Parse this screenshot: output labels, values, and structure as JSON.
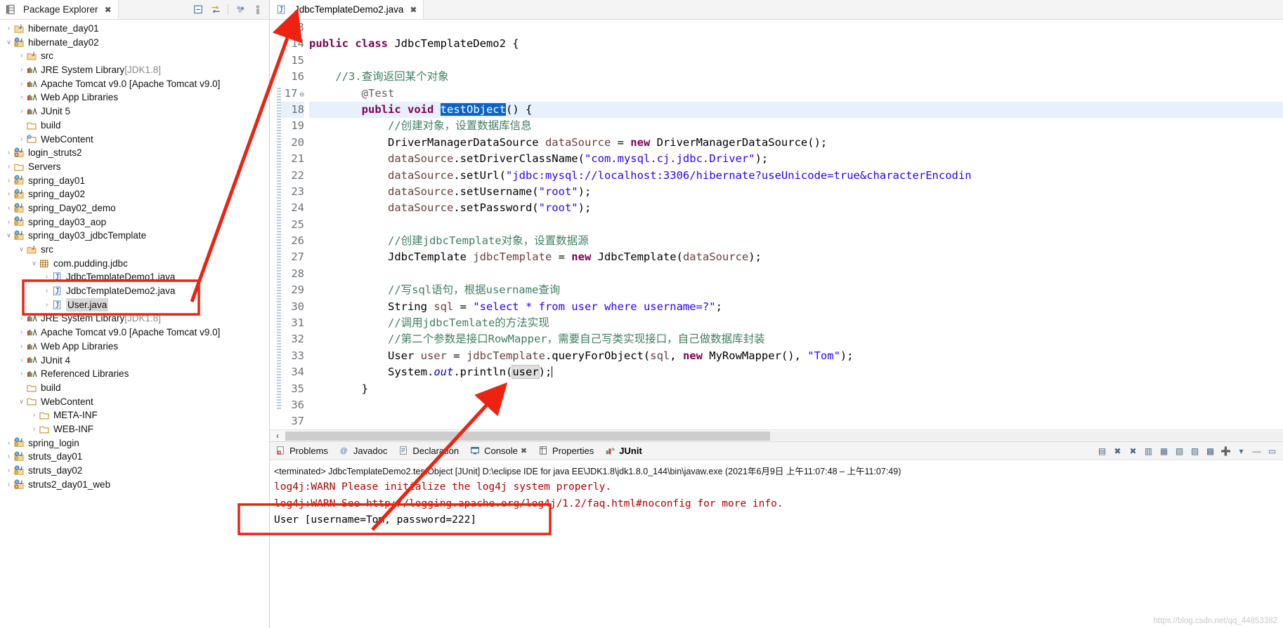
{
  "explorer": {
    "tab_title": "Package Explorer",
    "close_glyph": "✖",
    "toolbar": [
      {
        "name": "collapse-all-icon",
        "glyph": "▣"
      },
      {
        "name": "link-with-editor-icon",
        "glyph": "⇆"
      },
      {
        "name": "view-menu-icon",
        "glyph": "●"
      },
      {
        "name": "view-menu-chevron-icon",
        "glyph": "⋮"
      }
    ],
    "tree": [
      {
        "indent": 0,
        "arrow": "›",
        "icon": "java-project",
        "label": "hibernate_day01",
        "suffix": ""
      },
      {
        "indent": 0,
        "arrow": "ⱟ",
        "icon": "java-web-project",
        "label": "hibernate_day02",
        "suffix": ""
      },
      {
        "indent": 1,
        "arrow": "›",
        "icon": "source-folder",
        "label": "src",
        "suffix": ""
      },
      {
        "indent": 1,
        "arrow": "›",
        "icon": "library",
        "label": "JRE System Library",
        "suffix": "[JDK1.8]"
      },
      {
        "indent": 1,
        "arrow": "›",
        "icon": "library",
        "label": "Apache Tomcat v9.0 [Apache Tomcat v9.0]",
        "suffix": ""
      },
      {
        "indent": 1,
        "arrow": "›",
        "icon": "library",
        "label": "Web App Libraries",
        "suffix": ""
      },
      {
        "indent": 1,
        "arrow": "›",
        "icon": "library",
        "label": "JUnit 5",
        "suffix": ""
      },
      {
        "indent": 1,
        "arrow": "",
        "icon": "folder",
        "label": "build",
        "suffix": ""
      },
      {
        "indent": 1,
        "arrow": "›",
        "icon": "web-folder",
        "label": "WebContent",
        "suffix": ""
      },
      {
        "indent": 0,
        "arrow": "›",
        "icon": "java-web-project-error",
        "label": "login_struts2",
        "suffix": ""
      },
      {
        "indent": 0,
        "arrow": "›",
        "icon": "folder",
        "label": "Servers",
        "suffix": ""
      },
      {
        "indent": 0,
        "arrow": "›",
        "icon": "java-web-project",
        "label": "spring_day01",
        "suffix": ""
      },
      {
        "indent": 0,
        "arrow": "›",
        "icon": "java-web-project",
        "label": "spring_day02",
        "suffix": ""
      },
      {
        "indent": 0,
        "arrow": "›",
        "icon": "java-web-project",
        "label": "spring_Day02_demo",
        "suffix": ""
      },
      {
        "indent": 0,
        "arrow": "›",
        "icon": "java-web-project",
        "label": "spring_day03_aop",
        "suffix": ""
      },
      {
        "indent": 0,
        "arrow": "ⱟ",
        "icon": "java-web-project",
        "label": "spring_day03_jdbcTemplate",
        "suffix": ""
      },
      {
        "indent": 1,
        "arrow": "ⱟ",
        "icon": "source-folder",
        "label": "src",
        "suffix": ""
      },
      {
        "indent": 2,
        "arrow": "ⱟ",
        "icon": "package",
        "label": "com.pudding.jdbc",
        "suffix": ""
      },
      {
        "indent": 3,
        "arrow": "›",
        "icon": "java-file",
        "label": "JdbcTemplateDemo1.java",
        "suffix": ""
      },
      {
        "indent": 3,
        "arrow": "›",
        "icon": "java-file",
        "label": "JdbcTemplateDemo2.java",
        "suffix": ""
      },
      {
        "indent": 3,
        "arrow": "›",
        "icon": "java-file",
        "label": "User.java",
        "suffix": "",
        "selected": true
      },
      {
        "indent": 1,
        "arrow": "›",
        "icon": "library",
        "label": "JRE System Library",
        "suffix": "[JDK1.8]"
      },
      {
        "indent": 1,
        "arrow": "›",
        "icon": "library",
        "label": "Apache Tomcat v9.0 [Apache Tomcat v9.0]",
        "suffix": ""
      },
      {
        "indent": 1,
        "arrow": "›",
        "icon": "library",
        "label": "Web App Libraries",
        "suffix": ""
      },
      {
        "indent": 1,
        "arrow": "›",
        "icon": "library",
        "label": "JUnit 4",
        "suffix": ""
      },
      {
        "indent": 1,
        "arrow": "›",
        "icon": "library",
        "label": "Referenced Libraries",
        "suffix": ""
      },
      {
        "indent": 1,
        "arrow": "",
        "icon": "folder",
        "label": "build",
        "suffix": ""
      },
      {
        "indent": 1,
        "arrow": "ⱟ",
        "icon": "folder",
        "label": "WebContent",
        "suffix": ""
      },
      {
        "indent": 2,
        "arrow": "›",
        "icon": "folder",
        "label": "META-INF",
        "suffix": ""
      },
      {
        "indent": 2,
        "arrow": "›",
        "icon": "folder",
        "label": "WEB-INF",
        "suffix": ""
      },
      {
        "indent": 0,
        "arrow": "›",
        "icon": "java-web-project",
        "label": "spring_login",
        "suffix": ""
      },
      {
        "indent": 0,
        "arrow": "›",
        "icon": "java-web-project",
        "label": "struts_day01",
        "suffix": ""
      },
      {
        "indent": 0,
        "arrow": "›",
        "icon": "java-web-project",
        "label": "struts_day02",
        "suffix": ""
      },
      {
        "indent": 0,
        "arrow": "›",
        "icon": "java-web-project-error",
        "label": "struts2_day01_web",
        "suffix": ""
      }
    ]
  },
  "editor": {
    "tab_title": "JdbcTemplateDemo2.java",
    "close_glyph": "✖",
    "first_line": 13,
    "line_numbers": [
      13,
      14,
      15,
      16,
      17,
      18,
      19,
      20,
      21,
      22,
      23,
      24,
      25,
      26,
      27,
      28,
      29,
      30,
      31,
      32,
      33,
      34,
      35,
      36,
      37
    ],
    "current_line": 18,
    "selected_token": "testObject",
    "occurrence_token": "user",
    "scroll_left_glyph": "‹"
  },
  "console": {
    "tabs": [
      {
        "label": "Problems",
        "icon": "problems-icon",
        "active": false
      },
      {
        "label": "Javadoc",
        "icon": "javadoc-icon",
        "active": false
      },
      {
        "label": "Declaration",
        "icon": "declaration-icon",
        "active": false
      },
      {
        "label": "Console",
        "icon": "console-icon",
        "active": false,
        "closeable": true
      },
      {
        "label": "Properties",
        "icon": "properties-icon",
        "active": false
      },
      {
        "label": "JUnit",
        "icon": "junit-icon",
        "active": true
      }
    ],
    "toolbar": [
      {
        "name": "clear-console-icon",
        "glyph": "▤"
      },
      {
        "name": "terminate-icon",
        "glyph": "✖"
      },
      {
        "name": "remove-launch-icon",
        "glyph": "✖"
      },
      {
        "name": "display-selected-console-icon",
        "glyph": "▥"
      },
      {
        "name": "open-console-icon",
        "glyph": "▦"
      },
      {
        "name": "scroll-lock-icon",
        "glyph": "▧"
      },
      {
        "name": "word-wrap-icon",
        "glyph": "▨"
      },
      {
        "name": "pin-console-icon",
        "glyph": "▩"
      },
      {
        "name": "new-console-view-icon",
        "glyph": "➕"
      },
      {
        "name": "console-menu-chevron-icon",
        "glyph": "▾"
      },
      {
        "name": "minimize-icon",
        "glyph": "—"
      },
      {
        "name": "maximize-icon",
        "glyph": "▭"
      }
    ],
    "terminated_line": "<terminated> JdbcTemplateDemo2.testObject [JUnit] D:\\eclipse IDE for java EE\\JDK1.8\\jdk1.8.0_144\\bin\\javaw.exe (2021年6月9日 上午11:07:48 – 上午11:07:49)",
    "output": [
      {
        "text": "log4j:WARN Please initialize the log4j system properly.",
        "color": "red"
      },
      {
        "text": "log4j:WARN See http://logging.apache.org/log4j/1.2/faq.html#noconfig for more info.",
        "color": "red"
      },
      {
        "text": "User [username=Tom, password=222]",
        "color": "black"
      }
    ]
  },
  "watermark": "https://blog.csdn.net/qq_44853382",
  "code_lines": [
    {
      "n": 13,
      "segments": []
    },
    {
      "n": 14,
      "segments": [
        {
          "t": "public ",
          "c": "k"
        },
        {
          "t": "class ",
          "c": "k"
        },
        {
          "t": "JdbcTemplateDemo2 {",
          "c": ""
        }
      ]
    },
    {
      "n": 15,
      "segments": []
    },
    {
      "n": 16,
      "segments": [
        {
          "t": "    //3.查询返回某个对象",
          "c": "cm"
        }
      ]
    },
    {
      "n": 17,
      "segments": [
        {
          "t": "        @Test",
          "c": "an"
        }
      ],
      "fold": true
    },
    {
      "n": 18,
      "segments": [
        {
          "t": "        ",
          "c": ""
        },
        {
          "t": "public ",
          "c": "k"
        },
        {
          "t": "void ",
          "c": "k"
        },
        {
          "t": "testObject",
          "c": "selhl"
        },
        {
          "t": "() {",
          "c": ""
        }
      ],
      "current": true
    },
    {
      "n": 19,
      "segments": [
        {
          "t": "            //创建对象，设置数据库信息",
          "c": "cm"
        }
      ]
    },
    {
      "n": 20,
      "segments": [
        {
          "t": "            DriverManagerDataSource ",
          "c": ""
        },
        {
          "t": "dataSource",
          "c": "lv"
        },
        {
          "t": " = ",
          "c": ""
        },
        {
          "t": "new ",
          "c": "k"
        },
        {
          "t": "DriverManagerDataSource();",
          "c": ""
        }
      ]
    },
    {
      "n": 21,
      "segments": [
        {
          "t": "            ",
          "c": ""
        },
        {
          "t": "dataSource",
          "c": "lv"
        },
        {
          "t": ".setDriverClassName(",
          "c": ""
        },
        {
          "t": "\"com.mysql.cj.jdbc.Driver\"",
          "c": "st"
        },
        {
          "t": ");",
          "c": ""
        }
      ]
    },
    {
      "n": 22,
      "segments": [
        {
          "t": "            ",
          "c": ""
        },
        {
          "t": "dataSource",
          "c": "lv"
        },
        {
          "t": ".setUrl(",
          "c": ""
        },
        {
          "t": "\"jdbc:mysql://localhost:3306/hibernate?useUnicode=true&characterEncodin",
          "c": "st"
        }
      ]
    },
    {
      "n": 23,
      "segments": [
        {
          "t": "            ",
          "c": ""
        },
        {
          "t": "dataSource",
          "c": "lv"
        },
        {
          "t": ".setUsername(",
          "c": ""
        },
        {
          "t": "\"root\"",
          "c": "st"
        },
        {
          "t": ");",
          "c": ""
        }
      ]
    },
    {
      "n": 24,
      "segments": [
        {
          "t": "            ",
          "c": ""
        },
        {
          "t": "dataSource",
          "c": "lv"
        },
        {
          "t": ".setPassword(",
          "c": ""
        },
        {
          "t": "\"root\"",
          "c": "st"
        },
        {
          "t": ");",
          "c": ""
        }
      ]
    },
    {
      "n": 25,
      "segments": []
    },
    {
      "n": 26,
      "segments": [
        {
          "t": "            //创建jdbcTemplate对象，设置数据源",
          "c": "cm"
        }
      ]
    },
    {
      "n": 27,
      "segments": [
        {
          "t": "            JdbcTemplate ",
          "c": ""
        },
        {
          "t": "jdbcTemplate",
          "c": "lv"
        },
        {
          "t": " = ",
          "c": ""
        },
        {
          "t": "new ",
          "c": "k"
        },
        {
          "t": "JdbcTemplate(",
          "c": ""
        },
        {
          "t": "dataSource",
          "c": "lv"
        },
        {
          "t": ");",
          "c": ""
        }
      ]
    },
    {
      "n": 28,
      "segments": []
    },
    {
      "n": 29,
      "segments": [
        {
          "t": "            //写sql语句，根据username查询",
          "c": "cm"
        }
      ]
    },
    {
      "n": 30,
      "segments": [
        {
          "t": "            String ",
          "c": ""
        },
        {
          "t": "sql",
          "c": "lv"
        },
        {
          "t": " = ",
          "c": ""
        },
        {
          "t": "\"select * from user where username=?\"",
          "c": "st"
        },
        {
          "t": ";",
          "c": ""
        }
      ]
    },
    {
      "n": 31,
      "segments": [
        {
          "t": "            //调用jdbcTemlate的方法实现",
          "c": "cm"
        }
      ]
    },
    {
      "n": 32,
      "segments": [
        {
          "t": "            //第二个参数是接口RowMapper，需要自己写类实现接口，自己做数据库封装",
          "c": "cm"
        }
      ]
    },
    {
      "n": 33,
      "segments": [
        {
          "t": "            User ",
          "c": ""
        },
        {
          "t": "user",
          "c": "lv"
        },
        {
          "t": " = ",
          "c": ""
        },
        {
          "t": "jdbcTemplate",
          "c": "lv"
        },
        {
          "t": ".queryForObject(",
          "c": ""
        },
        {
          "t": "sql",
          "c": "lv"
        },
        {
          "t": ", ",
          "c": ""
        },
        {
          "t": "new ",
          "c": "k"
        },
        {
          "t": "MyRowMapper(), ",
          "c": ""
        },
        {
          "t": "\"Tom\"",
          "c": "st"
        },
        {
          "t": ");",
          "c": ""
        }
      ]
    },
    {
      "n": 34,
      "segments": [
        {
          "t": "            System.",
          "c": ""
        },
        {
          "t": "out",
          "c": "sf"
        },
        {
          "t": ".println(",
          "c": ""
        },
        {
          "t": "user",
          "c": "occ"
        },
        {
          "t": ");",
          "c": ""
        }
      ],
      "caret": true
    },
    {
      "n": 35,
      "segments": [
        {
          "t": "        }",
          "c": ""
        }
      ]
    },
    {
      "n": 36,
      "segments": []
    },
    {
      "n": 37,
      "segments": []
    }
  ]
}
